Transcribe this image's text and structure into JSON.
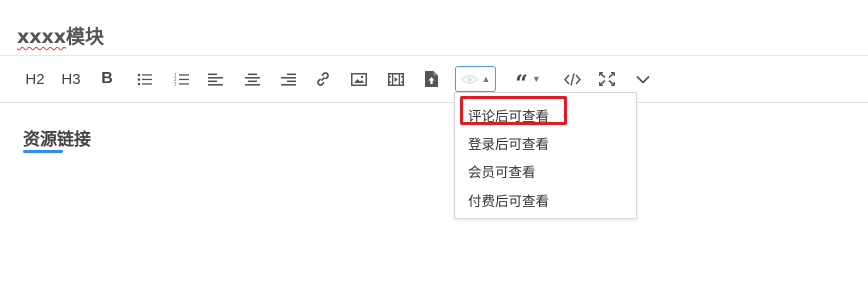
{
  "module_title": {
    "latin": "xxxx",
    "cjk": "模块"
  },
  "toolbar": {
    "h2": "H2",
    "h3": "H3",
    "bold": "B",
    "icons": [
      "unordered-list-icon",
      "ordered-list-icon",
      "align-left-icon",
      "align-center-icon",
      "align-right-icon",
      "link-icon",
      "image-icon",
      "video-icon",
      "file-upload-icon",
      "eye-hide-icon",
      "quote-icon",
      "code-icon",
      "fullscreen-icon",
      "chevron-down-icon"
    ]
  },
  "hide_menu": {
    "items": [
      "评论后可查看",
      "登录后可查看",
      "会员可查看",
      "付费后可查看"
    ],
    "highlighted_index": 0
  },
  "section": {
    "heading": "资源链接"
  },
  "colors": {
    "accent": "#2f8ff0",
    "highlight": "#e01b24",
    "selected_border": "#4a9fd8"
  }
}
